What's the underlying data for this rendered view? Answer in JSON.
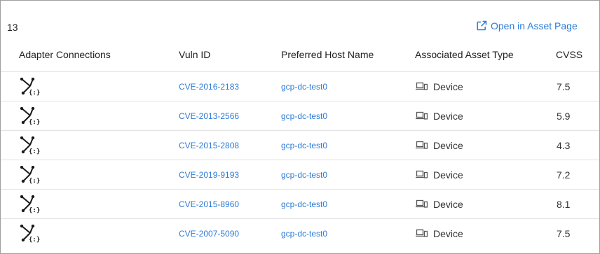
{
  "summary": {
    "count": "13"
  },
  "actions": {
    "open_in_asset_page": "Open in Asset Page"
  },
  "table": {
    "headers": {
      "adapter_connections": "Adapter Connections",
      "vuln_id": "Vuln ID",
      "preferred_host_name": "Preferred Host Name",
      "associated_asset_type": "Associated Asset Type",
      "cvss": "CVSS"
    },
    "rows": [
      {
        "vuln_id": "CVE-2016-2183",
        "host": "gcp-dc-test0",
        "asset_type": "Device",
        "cvss": "7.5"
      },
      {
        "vuln_id": "CVE-2013-2566",
        "host": "gcp-dc-test0",
        "asset_type": "Device",
        "cvss": "5.9"
      },
      {
        "vuln_id": "CVE-2015-2808",
        "host": "gcp-dc-test0",
        "asset_type": "Device",
        "cvss": "4.3"
      },
      {
        "vuln_id": "CVE-2019-9193",
        "host": "gcp-dc-test0",
        "asset_type": "Device",
        "cvss": "7.2"
      },
      {
        "vuln_id": "CVE-2015-8960",
        "host": "gcp-dc-test0",
        "asset_type": "Device",
        "cvss": "8.1"
      },
      {
        "vuln_id": "CVE-2007-5090",
        "host": "gcp-dc-test0",
        "asset_type": "Device",
        "cvss": "7.5"
      }
    ]
  },
  "colors": {
    "link": "#2d7bd6",
    "border": "#9e9e9e",
    "row_divider": "#e3e3e3"
  },
  "icons": {
    "open": "external-link-icon",
    "adapter": "adapter-connection-icon",
    "asset": "device-icon"
  }
}
